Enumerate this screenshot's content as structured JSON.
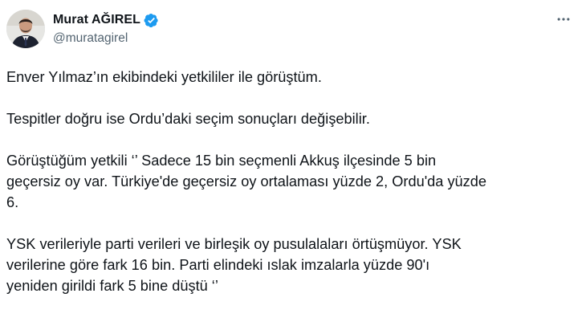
{
  "tweet": {
    "author": {
      "display_name": "Murat AĞIREL",
      "handle": "@muratagirel",
      "verified_icon": "verified-badge-icon",
      "verified_color": "#1d9bf0"
    },
    "more_icon": "more-horizontal-icon",
    "paragraphs": [
      "Enver Yılmaz’ın ekibindeki yetkililer ile görüştüm.",
      "Tespitler doğru ise Ordu’daki seçim sonuçları değişebilir.",
      "Görüştüğüm yetkili ‘’ Sadece 15 bin seçmenli Akkuş ilçesinde 5 bin\ngeçersiz oy var. Türkiye'de geçersiz oy ortalaması yüzde 2, Ordu'da yüzde\n6.",
      "YSK verileriyle parti verileri ve birleşik oy pusulalaları örtüşmüyor. YSK\nverilerine göre fark 16 bin. Parti elindeki ıslak imzalarla yüzde 90'ı\nyeniden girildi fark 5 bine düştü ‘’"
    ]
  }
}
